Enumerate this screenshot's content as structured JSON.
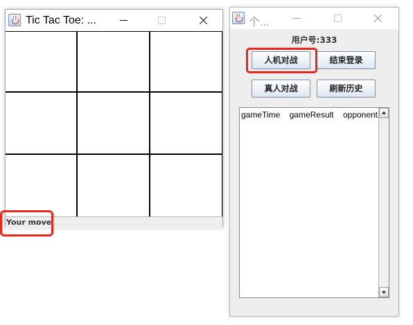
{
  "tictactoe_window": {
    "title": "Tic Tac Toe: ...",
    "board": {
      "cells": [
        "",
        "",
        "",
        "",
        "",
        "",
        "",
        "",
        ""
      ]
    },
    "status": "Your move"
  },
  "personal_window": {
    "title": "个...",
    "user_label": "用户号:333",
    "buttons": {
      "ai_battle": "人机对战",
      "logout": "结束登录",
      "pvp_battle": "真人对战",
      "refresh_history": "刷新历史"
    },
    "history": {
      "columns": [
        "gameTime",
        "gameResult",
        "opponent"
      ],
      "rows": []
    }
  },
  "colors": {
    "annotation_highlight": "#e8261c",
    "button_border": "#7a8ea8",
    "grid_line": "#000000"
  }
}
